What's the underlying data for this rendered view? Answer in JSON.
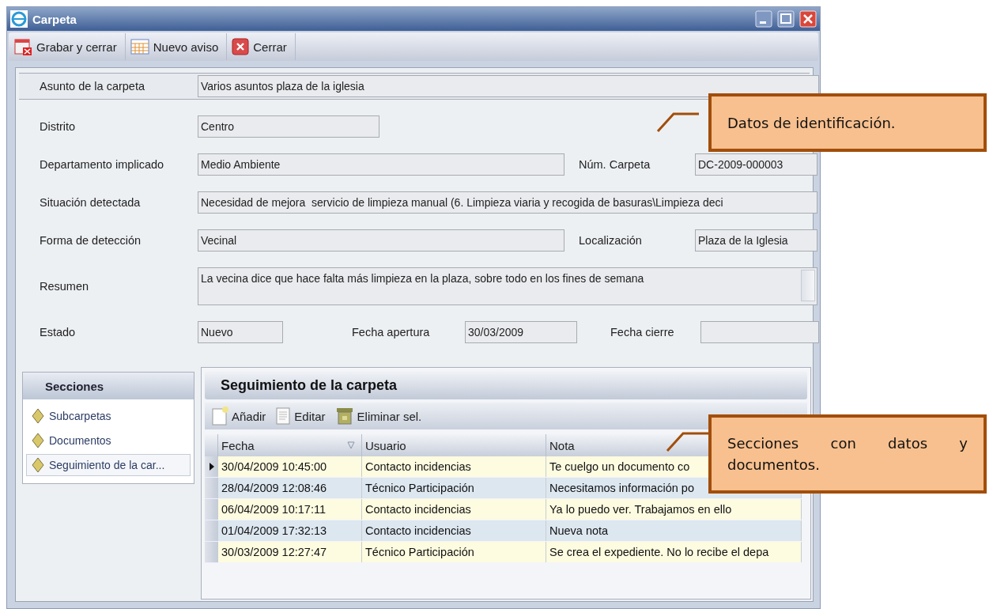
{
  "window": {
    "title": "Carpeta"
  },
  "toolbar": [
    {
      "label": "Grabar y cerrar",
      "kind": "save"
    },
    {
      "label": "Nuevo aviso",
      "kind": "calendar"
    },
    {
      "label": "Cerrar",
      "kind": "close"
    }
  ],
  "subject": {
    "label": "Asunto de la carpeta",
    "value": "Varios asuntos plaza de la iglesia"
  },
  "form_rows": [
    [
      {
        "label": "Distrito",
        "value": "Centro",
        "kind": "short"
      }
    ],
    [
      {
        "label": "Departamento implicado",
        "value": "Medio Ambiente",
        "kind": "wide"
      },
      {
        "label": "Núm. Carpeta",
        "value": "DC-2009-000003",
        "kind": "side"
      }
    ],
    [
      {
        "label": "Situación detectada",
        "value": "Necesidad de mejora  servicio de limpieza manual (6. Limpieza viaria y recogida de basuras\\Limpieza deci",
        "kind": "full"
      }
    ],
    [
      {
        "label": "Forma de detección",
        "value": "Vecinal",
        "kind": "wide"
      },
      {
        "label": "Localización",
        "value": "Plaza de la Iglesia",
        "kind": "side"
      }
    ],
    [
      {
        "label": "Resumen",
        "value": "La vecina dice que hace falta más limpieza en la plaza, sobre todo en los fines de semana",
        "kind": "multiline"
      }
    ],
    [
      {
        "label": "Estado",
        "value": "Nuevo",
        "kind": "tiny"
      },
      {
        "label": "Fecha apertura",
        "value": "30/03/2009",
        "kind": "date"
      },
      {
        "label": "Fecha cierre",
        "kind": "date_end"
      }
    ]
  ],
  "sections": {
    "title": "Secciones",
    "items": [
      {
        "label": "Subcarpetas",
        "selected": false
      },
      {
        "label": "Documentos",
        "selected": false
      },
      {
        "label": "Seguimiento de la car...",
        "selected": true
      }
    ]
  },
  "tracking": {
    "title": "Seguimiento de la carpeta",
    "actions": [
      {
        "label": "Añadir",
        "kind": "add"
      },
      {
        "label": "Editar",
        "kind": "edit"
      },
      {
        "label": "Eliminar sel.",
        "kind": "delete"
      }
    ],
    "columns": [
      {
        "label": "Fecha",
        "sorted": true
      },
      {
        "label": "Usuario",
        "sorted": false
      },
      {
        "label": "Nota",
        "sorted": false
      }
    ],
    "rows": [
      {
        "cells": [
          "30/04/2009 10:45:00",
          "Contacto incidencias",
          "Te cuelgo un documento co"
        ],
        "current": true
      },
      {
        "cells": [
          "28/04/2009 12:08:46",
          "Técnico Participación",
          "Necesitamos información po"
        ],
        "current": false
      },
      {
        "cells": [
          "06/04/2009 10:17:11",
          "Contacto incidencias",
          "Ya lo puedo ver. Trabajamos en ello"
        ],
        "current": false
      },
      {
        "cells": [
          "01/04/2009 17:32:13",
          "Contacto incidencias",
          "Nueva nota"
        ],
        "current": false
      },
      {
        "cells": [
          "30/03/2009 12:27:47",
          "Técnico Participación",
          "Se crea el expediente. No lo recibe el depa"
        ],
        "current": false
      }
    ]
  },
  "callouts": [
    {
      "text": "Datos de identificación.",
      "kind": "top"
    },
    {
      "text": "Secciones con datos y documentos.",
      "kind": "bottom"
    }
  ]
}
